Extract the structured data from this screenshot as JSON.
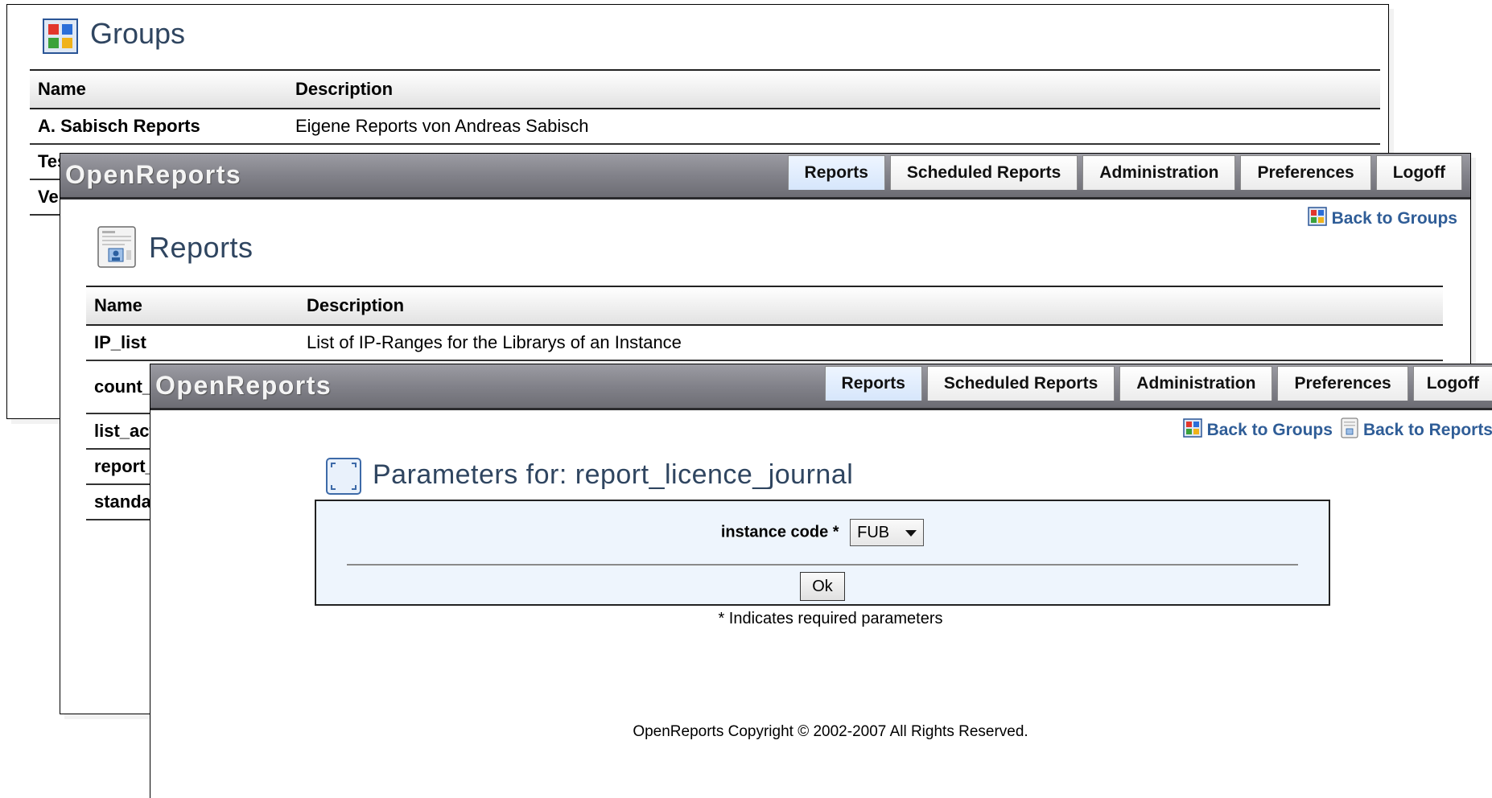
{
  "groups_window": {
    "title": "Groups",
    "table": {
      "headers": [
        "Name",
        "Description"
      ],
      "rows": [
        {
          "name": "A. Sabisch Reports",
          "description": "Eigene Reports von Andreas Sabisch"
        },
        {
          "name": "Tes",
          "description": ""
        },
        {
          "name": "Ve",
          "description": ""
        }
      ]
    }
  },
  "reports_window": {
    "brand": "OpenReports",
    "tabs": [
      "Reports",
      "Scheduled Reports",
      "Administration",
      "Preferences",
      "Logoff"
    ],
    "active_tab": "Reports",
    "back_to_groups": "Back to Groups",
    "title": "Reports",
    "table": {
      "headers": [
        "Name",
        "Description"
      ],
      "rows": [
        {
          "name": "IP_list",
          "description": "List of IP-Ranges for the Librarys of an Instance"
        },
        {
          "name": "count_",
          "description": ""
        },
        {
          "name": "list_act",
          "description": ""
        },
        {
          "name": "report_",
          "description": ""
        },
        {
          "name": "standa",
          "description": ""
        }
      ]
    }
  },
  "params_window": {
    "brand": "OpenReports",
    "tabs": [
      "Reports",
      "Scheduled Reports",
      "Administration",
      "Preferences",
      "Logoff"
    ],
    "active_tab": "Reports",
    "back_to_groups": "Back to Groups",
    "back_to_reports": "Back to Reports",
    "title": "Parameters for: report_licence_journal",
    "form": {
      "field_label": "instance code *",
      "select_value": "FUB",
      "ok_label": "Ok"
    },
    "required_note": "* Indicates required parameters",
    "copyright": "OpenReports Copyright © 2002-2007 All Rights Reserved."
  },
  "colors": {
    "title_text": "#2f4560",
    "link": "#2f5d97",
    "form_background": "#eef5fd",
    "active_tab": "#d6e6fb"
  },
  "icons": [
    "groups-icon",
    "reports-icon",
    "parameters-icon"
  ]
}
